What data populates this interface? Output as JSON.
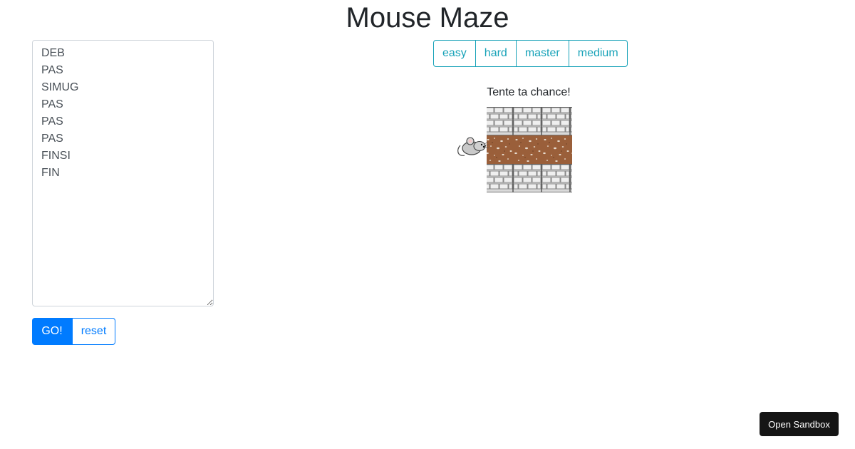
{
  "header": {
    "title": "Mouse Maze"
  },
  "editor": {
    "code": "DEB\nPAS\nSIMUG\nPAS\nPAS\nPAS\nFINSI\nFIN"
  },
  "controls": {
    "go_label": "GO!",
    "reset_label": "reset"
  },
  "levels": [
    {
      "label": "easy"
    },
    {
      "label": "hard"
    },
    {
      "label": "master"
    },
    {
      "label": "medium"
    }
  ],
  "game": {
    "status": "Tente ta chance!",
    "grid_rows": 3,
    "grid_cols": 3,
    "path_row": 2,
    "mouse_position": "left of path entrance, facing right",
    "tiles": [
      "wall",
      "wall",
      "wall",
      "dirt",
      "dirt",
      "dirt",
      "wall",
      "wall",
      "wall"
    ]
  },
  "sandbox": {
    "label": "Open Sandbox"
  },
  "colors": {
    "primary": "#007bff",
    "info": "#17a2b8",
    "wall": "#d3d3d3",
    "dirt": "#9a5f3a",
    "sandbox_bg": "#151515"
  }
}
